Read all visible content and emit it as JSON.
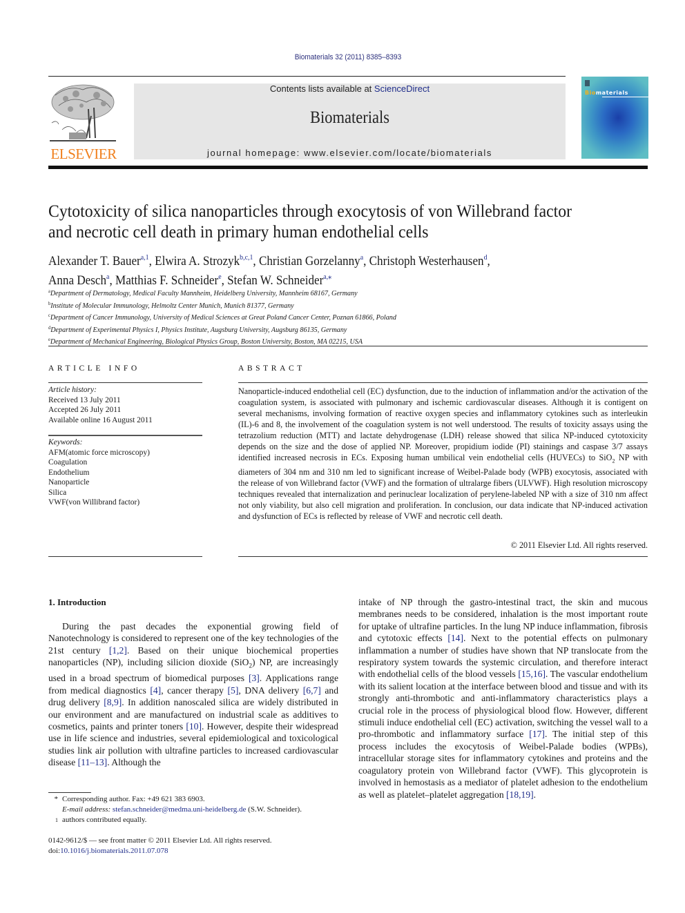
{
  "journal_citation": "Biomaterials 32 (2011) 8385–8393",
  "header": {
    "publisher_logo": "ELSEVIER",
    "contents_prefix": "Contents lists available at ",
    "contents_link": "ScienceDirect",
    "journal_name": "Biomaterials",
    "homepage": "journal homepage: www.elsevier.com/locate/biomaterials",
    "cover_title_bio": "Bio",
    "cover_title_rest": "materials",
    "colors": {
      "publisher_orange": "#f07f1c",
      "link_blue": "#1f2d8a",
      "banner_gray": "#e6e6e6"
    }
  },
  "article": {
    "title_line1": "Cytotoxicity of silica nanoparticles through exocytosis of von Willebrand factor",
    "title_line2": "and necrotic cell death in primary human endothelial cells",
    "authors": [
      {
        "name": "Alexander T. Bauer",
        "sup": "a,1",
        "sep": ", "
      },
      {
        "name": "Elwira A. Strozyk",
        "sup": "b,c,1",
        "sep": ", "
      },
      {
        "name": "Christian Gorzelanny",
        "sup": "a",
        "sep": ", "
      },
      {
        "name": "Christoph Westerhausen",
        "sup": "d",
        "sep": ","
      },
      {
        "name": "Anna Desch",
        "sup": "a",
        "sep": ", "
      },
      {
        "name": "Matthias F. Schneider",
        "sup": "e",
        "sep": ", "
      },
      {
        "name": "Stefan W. Schneider",
        "sup": "a,⁎",
        "sep": ""
      }
    ],
    "affiliations": [
      {
        "key": "a",
        "text": "Department of Dermatology, Medical Faculty Mannheim, Heidelberg University, Mannheim 68167, Germany"
      },
      {
        "key": "b",
        "text": "Institute of Molecular Immunology, Helmoltz Center Munich, Munich 81377, Germany"
      },
      {
        "key": "c",
        "text": "Department of Cancer Immunology, University of Medical Sciences at Great Poland Cancer Center, Poznan 61866, Poland"
      },
      {
        "key": "d",
        "text": "Department of Experimental Physics I, Physics Institute, Augsburg University, Augsburg 86135, Germany"
      },
      {
        "key": "e",
        "text": "Department of Mechanical Engineering, Biological Physics Group, Boston University, Boston, MA 02215, USA"
      }
    ]
  },
  "article_info": {
    "label": "ARTICLE INFO",
    "history_label": "Article history:",
    "received": "Received 13 July 2011",
    "accepted": "Accepted 26 July 2011",
    "online": "Available online 16 August 2011",
    "keywords_label": "Keywords:",
    "keywords": [
      "AFM(atomic force microscopy)",
      "Coagulation",
      "Endothelium",
      "Nanoparticle",
      "Silica",
      "VWF(von Willibrand factor)"
    ]
  },
  "abstract": {
    "label": "ABSTRACT",
    "text_before_sio2": "Nanoparticle-induced endothelial cell (EC) dysfunction, due to the induction of inflammation and/or the activation of the coagulation system, is associated with pulmonary and ischemic cardiovascular diseases. Although it is contigent on several mechanisms, involving formation of reactive oxygen species and inflammatory cytokines such as interleukin (IL)-6 and 8, the involvement of the coagulation system is not well understood. The results of toxicity assays using the tetrazolium reduction (MTT) and lactate dehydrogenase (LDH) release showed that silica NP-induced cytotoxicity depends on the size and the dose of applied NP. Moreover, propidium iodide (PI) stainings and caspase 3/7 assays identified increased necrosis in ECs. Exposing human umbilical vein endothelial cells (HUVECs) to SiO",
    "sio2_sub": "2",
    "text_after_sio2": " NP with diameters of 304 nm and 310 nm led to significant increase of Weibel-Palade body (WPB) exocytosis, associated with the release of von Willebrand factor (VWF) and the formation of ultralarge fibers (ULVWF). High resolution microscopy techniques revealed that internalization and perinuclear localization of perylene-labeled NP with a size of 310 nm affect not only viability, but also cell migration and proliferation. In conclusion, our data indicate that NP-induced activation and dysfunction of ECs is reflected by release of VWF and necrotic cell death.",
    "copyright": "© 2011 Elsevier Ltd. All rights reserved."
  },
  "introduction": {
    "heading": "1.  Introduction",
    "left": {
      "p1": "During the past decades the exponential growing field of Nanotechnology is considered to represent one of the key technologies of the 21st century ",
      "r1": "[1,2]",
      "p2": ". Based on their unique biochemical properties nanoparticles (NP), including silicion dioxide (SiO",
      "sub": "2",
      "p3": ") NP, are increasingly used in a broad spectrum of biomedical purposes ",
      "r2": "[3]",
      "p4": ". Applications range from medical diagnostics ",
      "r3": "[4]",
      "p5": ", cancer therapy ",
      "r4": "[5]",
      "p6": ", DNA delivery ",
      "r5": "[6,7]",
      "p7": " and drug delivery ",
      "r6": "[8,9]",
      "p8": ". In addition nanoscaled silica are widely distributed in our environment and are manufactured on industrial scale as additives to cosmetics, paints and printer toners ",
      "r7": "[10]",
      "p9": ". However, despite their widespread use in life science and industries, several epidemiological and toxicological studies link air pollution with ultrafine particles to increased cardiovascular disease ",
      "r8": "[11–13]",
      "p10": ". Although the"
    },
    "right": {
      "p1": "intake of NP through the gastro-intestinal tract, the skin and mucous membranes needs to be considered, inhalation is the most important route for uptake of ultrafine particles. In the lung NP induce inflammation, fibrosis and cytotoxic effects ",
      "r1": "[14]",
      "p2": ". Next to the potential effects on pulmonary inflammation a number of studies have shown that NP translocate from the respiratory system towards the systemic circulation, and therefore interact with endothelial cells of the blood vessels ",
      "r2": "[15,16]",
      "p3": ". The vascular endothelium with its salient location at the interface between blood and tissue and with its strongly anti-thrombotic and anti-inflammatory characteristics plays a crucial role in the process of physiological blood flow. However, different stimuli induce endothelial cell (EC) activation, switching the vessel wall to a pro-thrombotic and inflammatory surface ",
      "r3": "[17]",
      "p4": ". The initial step of this process includes the exocytosis of Weibel-Palade bodies (WPBs), intracellular storage sites for inflammatory cytokines and proteins and the coagulatory protein von Willebrand factor (VWF). This glycoprotein is involved in hemostasis as a mediator of platelet adhesion to the endothelium as well as platelet–platelet aggregation ",
      "r4": "[18,19]",
      "p5": "."
    }
  },
  "footnotes": {
    "corresponding_mark": "*",
    "corresponding": "Corresponding author. Fax: +49 621 383 6903.",
    "email_label": "E-mail address: ",
    "email": "stefan.schneider@medma.uni-heidelberg.de",
    "email_suffix": " (S.W. Schneider).",
    "equal_mark": "1",
    "equal": "authors contributed equally."
  },
  "front_matter": {
    "issn_line": "0142-9612/$ — see front matter © 2011 Elsevier Ltd. All rights reserved.",
    "doi_label": "doi:",
    "doi": "10.1016/j.biomaterials.2011.07.078"
  }
}
